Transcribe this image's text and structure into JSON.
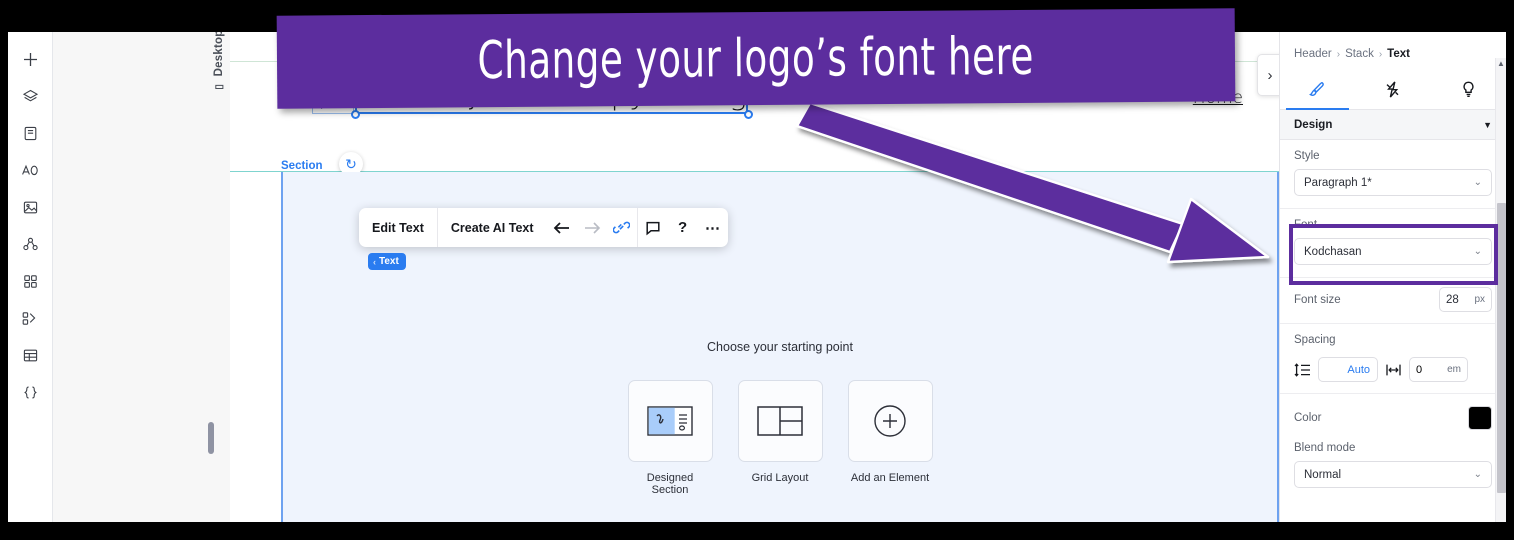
{
  "annotation": {
    "banner_text": "Change your logo’s font here",
    "banner_color": "#5C2D9E",
    "arrow_color": "#5C2D9E",
    "highlight_color": "#5C2D9E"
  },
  "left_rail": {
    "items": [
      {
        "name": "add-icon",
        "label": "Add"
      },
      {
        "name": "layers-icon",
        "label": "Layers"
      },
      {
        "name": "pages-icon",
        "label": "Pages"
      },
      {
        "name": "text-icon",
        "label": "Text"
      },
      {
        "name": "image-icon",
        "label": "Media"
      },
      {
        "name": "cms-icon",
        "label": "CMS"
      },
      {
        "name": "apps-icon",
        "label": "Apps"
      },
      {
        "name": "dev-mode-icon",
        "label": "Dev Mode"
      },
      {
        "name": "table-icon",
        "label": "Table"
      },
      {
        "name": "code-icon",
        "label": "Code"
      }
    ]
  },
  "canvas": {
    "device_label": "Desktop (Primary)",
    "section_label": "Section",
    "logo_text": "Robert Jordan Copywriting",
    "nav_link": "Home",
    "collapse_glyph": "›",
    "rotate_glyph": "↻",
    "text_badge": "Text",
    "text_badge_chev": "‹",
    "starting_point_title": "Choose your starting point",
    "cards": [
      {
        "label": "Designed Section",
        "icon": "designed-section-icon"
      },
      {
        "label": "Grid Layout",
        "icon": "grid-layout-icon"
      },
      {
        "label": "Add an Element",
        "icon": "add-element-icon"
      }
    ]
  },
  "toolbar": {
    "edit_text": "Edit Text",
    "create_ai_text": "Create AI Text",
    "undo_glyph": "←",
    "redo_glyph": "→",
    "link_glyph": "🔗",
    "comment_glyph": "▭",
    "help_glyph": "?",
    "more_glyph": "⋯"
  },
  "panel": {
    "breadcrumb": [
      "Header",
      "Stack",
      "Text"
    ],
    "breadcrumb_sep": "›",
    "tabs": [
      {
        "name": "design-tab",
        "icon": "paintbrush-icon",
        "active": true
      },
      {
        "name": "animation-tab",
        "icon": "lightning-icon",
        "active": false
      },
      {
        "name": "insights-tab",
        "icon": "lightbulb-icon",
        "active": false
      }
    ],
    "section_title": "Design",
    "section_chevron": "▼",
    "style": {
      "label": "Style",
      "value": "Paragraph 1*",
      "chevron": "⌄"
    },
    "font": {
      "label": "Font",
      "value": "Kodchasan",
      "chevron": "⌄"
    },
    "font_size": {
      "label": "Font size",
      "value": "28",
      "unit": "px"
    },
    "spacing": {
      "label": "Spacing",
      "line_height_value": "Auto",
      "letter_spacing_value": "0",
      "letter_spacing_unit": "em"
    },
    "color": {
      "label": "Color",
      "value": "#000000"
    },
    "blend_mode": {
      "label": "Blend mode",
      "value": "Normal",
      "chevron": "⌄"
    }
  }
}
